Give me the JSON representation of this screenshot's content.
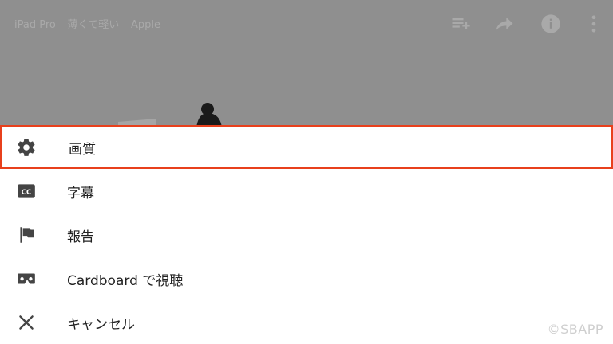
{
  "video": {
    "title": "iPad Pro – 薄くて軽い – Apple",
    "icons": [
      "add-to-playlist-icon",
      "share-icon",
      "info-icon",
      "more-vert-icon"
    ]
  },
  "menu": {
    "items": [
      {
        "icon": "gear-icon",
        "label": "画質",
        "highlighted": true
      },
      {
        "icon": "closed-caption-icon",
        "label": "字幕"
      },
      {
        "icon": "flag-icon",
        "label": "報告"
      },
      {
        "icon": "vr-cardboard-icon",
        "label": "Cardboard で視聴"
      },
      {
        "icon": "close-icon",
        "label": "キャンセル"
      }
    ]
  },
  "highlight_color": "#e8401c",
  "watermark": "©SBAPP"
}
